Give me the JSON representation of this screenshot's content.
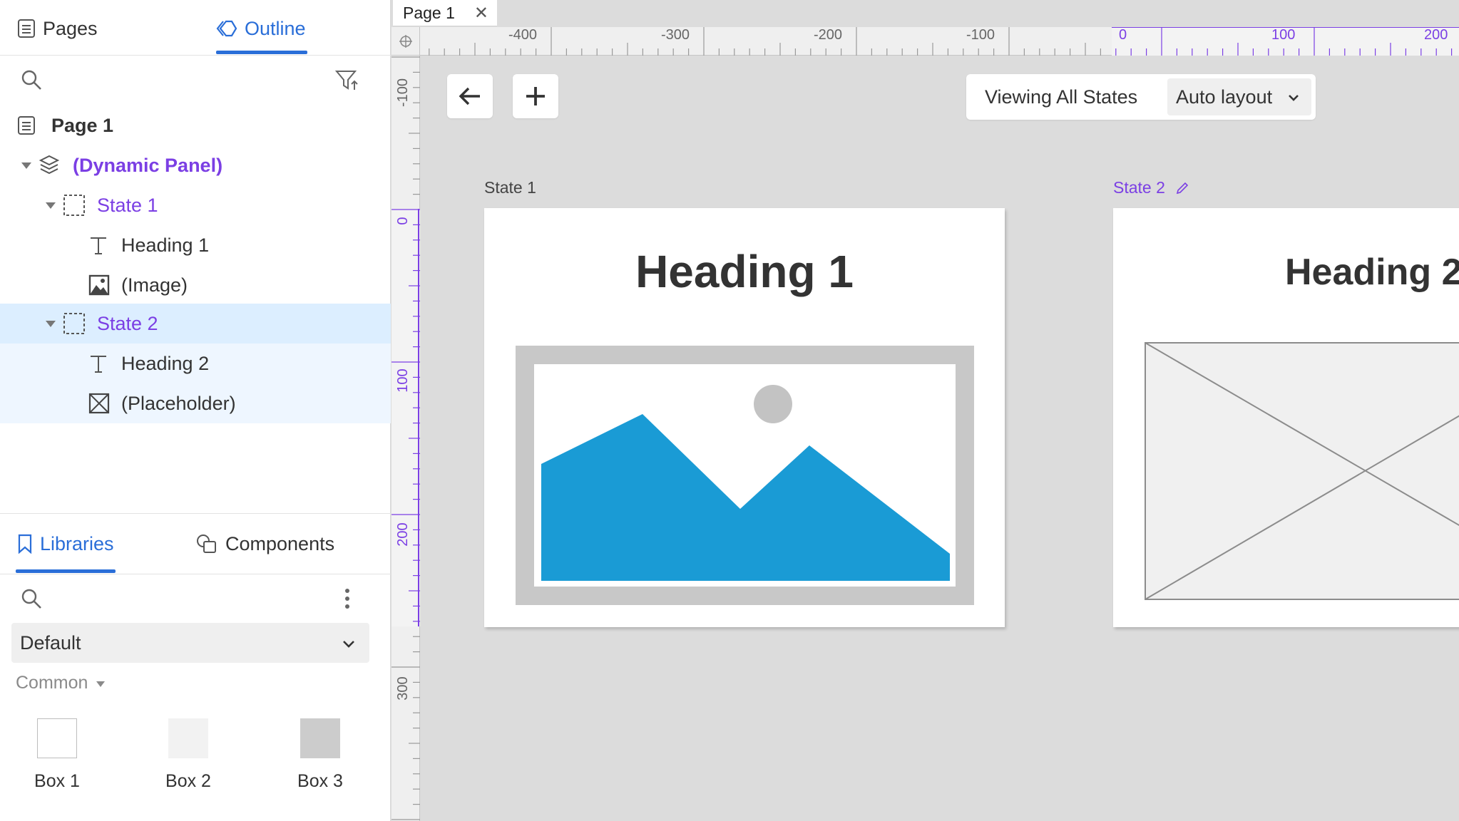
{
  "left_tabs": {
    "pages": "Pages",
    "outline": "Outline"
  },
  "tree": {
    "page": "Page 1",
    "panel": "(Dynamic Panel)",
    "state1": "State 1",
    "heading1": "Heading 1",
    "image": "(Image)",
    "state2": "State 2",
    "heading2": "Heading 2",
    "placeholder": "(Placeholder)"
  },
  "lib_tabs": {
    "libraries": "Libraries",
    "components": "Components"
  },
  "library": {
    "selected": "Default",
    "group": "Common",
    "items": [
      {
        "name": "Box 1",
        "color": "#ffffff"
      },
      {
        "name": "Box 2",
        "color": "#f2f2f2"
      },
      {
        "name": "Box 3",
        "color": "#cccccc"
      }
    ]
  },
  "canvas": {
    "doc_tab": "Page 1",
    "view_label": "Viewing All States",
    "layout_value": "Auto layout",
    "state1_label": "State 1",
    "state2_label": "State 2",
    "heading1": "Heading 1",
    "heading2": "Heading 2",
    "hruler_labels": [
      "-400",
      "-300",
      "-200",
      "-100",
      "0",
      "100",
      "200"
    ],
    "vruler_labels": [
      "-100",
      "0",
      "100",
      "200",
      "300"
    ]
  },
  "colors": {
    "accent": "#2a6ed8",
    "purple": "#7b3fe4",
    "image_blue": "#1a9bd5"
  }
}
